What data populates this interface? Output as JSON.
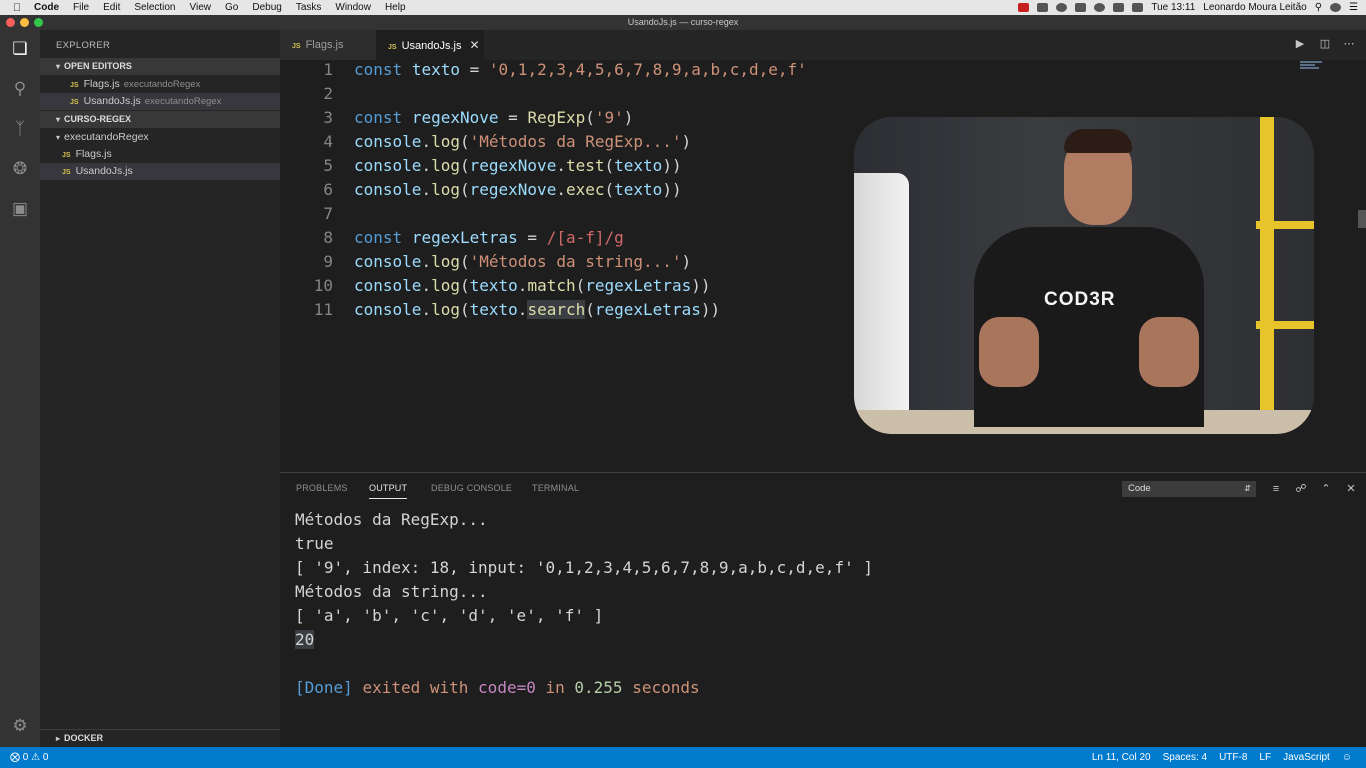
{
  "menubar": {
    "app_name": "Code",
    "items": [
      "File",
      "Edit",
      "Selection",
      "View",
      "Go",
      "Debug",
      "Tasks",
      "Window",
      "Help"
    ],
    "clock": "Tue 13:11",
    "user": "Leonardo Moura Leitão"
  },
  "window": {
    "title": "UsandoJs.js — curso-regex"
  },
  "activity_icons": [
    "files-icon",
    "search-icon",
    "source-control-icon",
    "debug-icon",
    "extensions-icon",
    "settings-gear-icon"
  ],
  "sidebar": {
    "title": "EXPLORER",
    "open_editors": {
      "header": "OPEN EDITORS",
      "items": [
        {
          "name": "Flags.js",
          "folder": "executandoRegex"
        },
        {
          "name": "UsandoJs.js",
          "folder": "executandoRegex"
        }
      ]
    },
    "project": {
      "header": "CURSO-REGEX",
      "folder": "executandoRegex",
      "files": [
        "Flags.js",
        "UsandoJs.js"
      ]
    },
    "docker_header": "DOCKER",
    "file_badge": "JS"
  },
  "tabs": [
    {
      "label": "Flags.js",
      "active": false
    },
    {
      "label": "UsandoJs.js",
      "active": true
    }
  ],
  "editor": {
    "line_numbers": [
      "1",
      "2",
      "3",
      "4",
      "5",
      "6",
      "7",
      "8",
      "9",
      "10",
      "11"
    ],
    "lines": [
      "const texto = '0,1,2,3,4,5,6,7,8,9,a,b,c,d,e,f'",
      "",
      "const regexNove = RegExp('9')",
      "console.log('Métodos da RegExp...')",
      "console.log(regexNove.test(texto))",
      "console.log(regexNove.exec(texto))",
      "",
      "const regexLetras = /[a-f]/g",
      "console.log('Métodos da string...')",
      "console.log(texto.match(regexLetras))",
      "console.log(texto.search(regexLetras))"
    ]
  },
  "video_overlay": {
    "logo_text": "COD3R"
  },
  "panel": {
    "tabs": [
      "PROBLEMS",
      "OUTPUT",
      "DEBUG CONSOLE",
      "TERMINAL"
    ],
    "active_tab": "OUTPUT",
    "channel": "Code",
    "output_lines": [
      "Métodos da RegExp...",
      "true",
      "[ '9', index: 18, input: '0,1,2,3,4,5,6,7,8,9,a,b,c,d,e,f' ]",
      "Métodos da string...",
      "[ 'a', 'b', 'c', 'd', 'e', 'f' ]",
      "20"
    ],
    "done": {
      "tag": "[Done]",
      "text1": "exited with",
      "code": "code=0",
      "text2": "in",
      "seconds_value": "0.255",
      "seconds_label": "seconds"
    }
  },
  "statusbar": {
    "errors": "0",
    "warnings": "0",
    "position": "Ln 11, Col 20",
    "spaces": "Spaces: 4",
    "encoding": "UTF-8",
    "eol": "LF",
    "language": "JavaScript"
  },
  "colors": {
    "statusbar": "#007acc",
    "keyword": "#569cd6",
    "string": "#ce9178",
    "function": "#dcdcaa",
    "variable": "#9cdcfe"
  }
}
